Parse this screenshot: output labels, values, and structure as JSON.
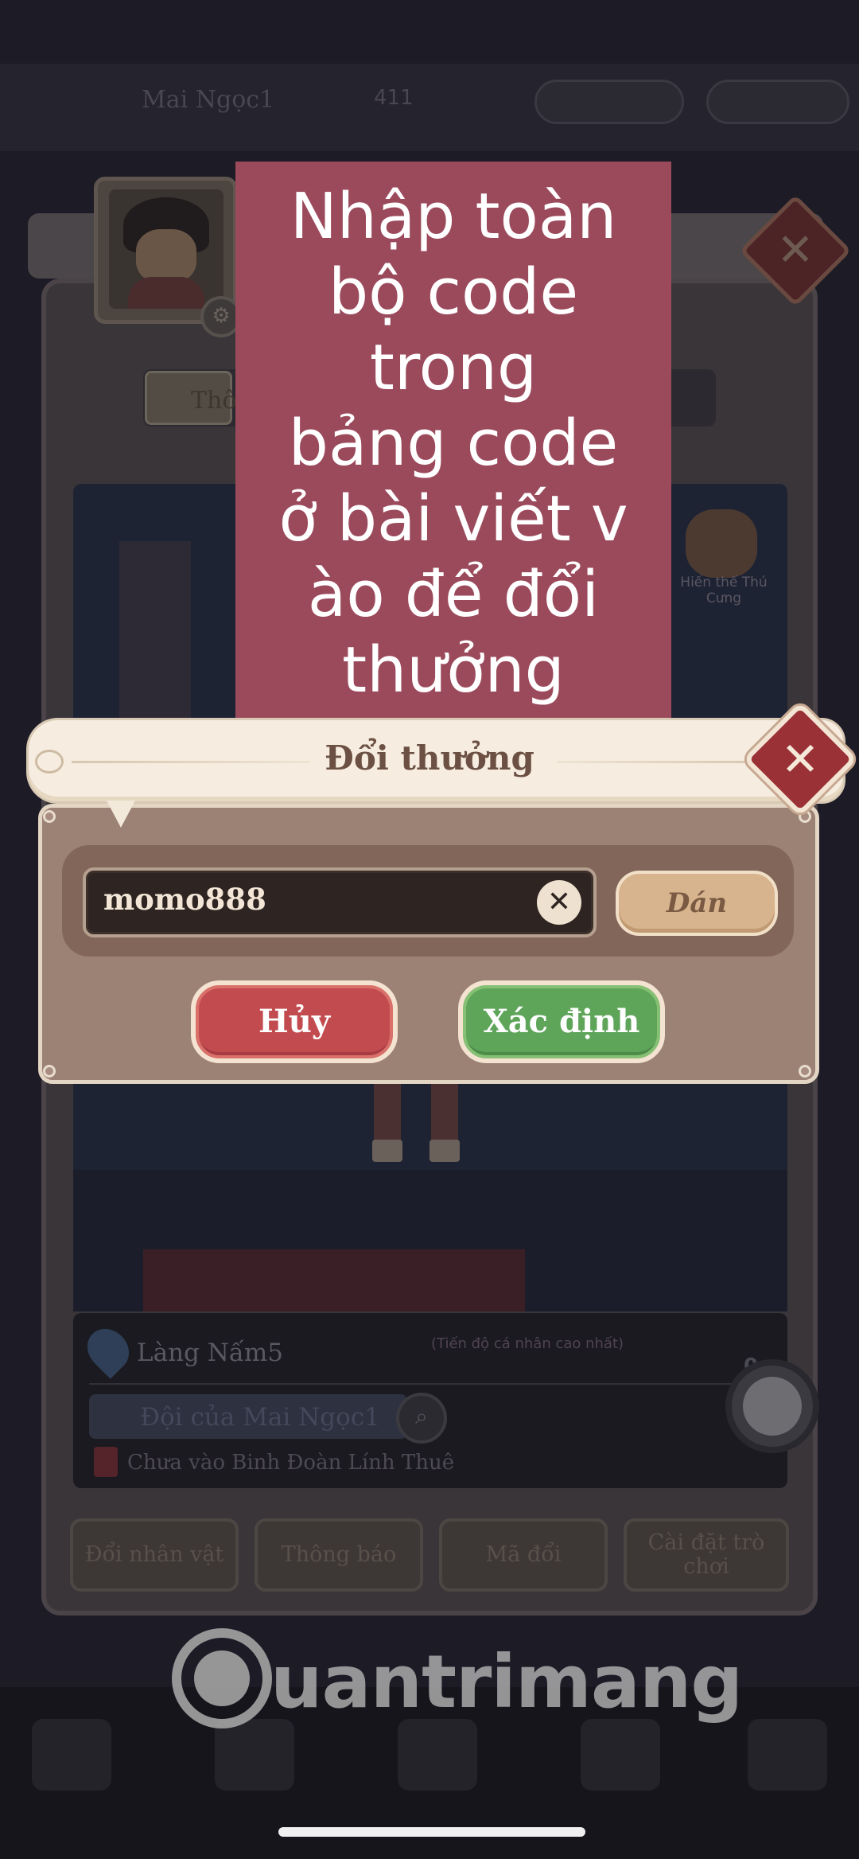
{
  "background": {
    "player_name": "Mai Ngọc1",
    "player_level": "411",
    "tab_label": "Thô",
    "pet_label": "Hiến thế Thú Cưng",
    "location": "Làng Nấm5",
    "progress_note": "(Tiến độ cá nhân cao nhất)",
    "online_count": "0",
    "team_name": "Đội của Mai Ngọc1",
    "guild_status": "Chưa vào Binh Đoàn Lính Thuê",
    "buttons": [
      {
        "label": "Đổi nhân vật"
      },
      {
        "label": "Thông báo"
      },
      {
        "label": "Mã đổi"
      },
      {
        "label": "Cài đặt trò chơi"
      }
    ]
  },
  "overlay": {
    "text": "Nhập toàn\nbộ code\ntrong\nbảng code\nở bài viết v\nào để đổi\nthưởng"
  },
  "dialog": {
    "title": "Đổi thưởng",
    "close_glyph": "✕",
    "input_value": "momo888",
    "clear_glyph": "✕",
    "paste_label": "Dán",
    "cancel_label": "Hủy",
    "confirm_label": "Xác định"
  },
  "watermark": {
    "text": "uantrimang"
  },
  "icons": {
    "gear": "gear-icon",
    "close": "close-icon",
    "location": "location-pin-icon",
    "search": "search-icon",
    "clear": "clear-icon"
  },
  "colors": {
    "overlay_bg": "#9b4a5c",
    "cancel_button": "#c24b4f",
    "confirm_button": "#5ea55a",
    "paste_button": "#d7b48e",
    "dialog_body": "#9c8175",
    "close_button": "#9a3137"
  }
}
